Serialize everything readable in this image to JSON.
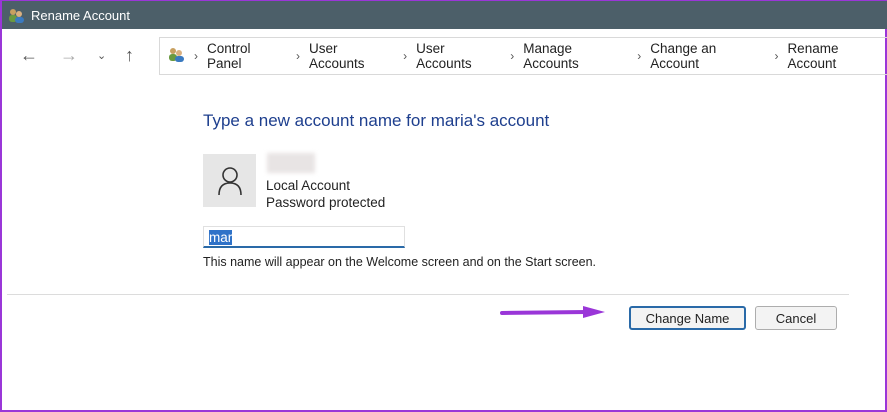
{
  "window": {
    "title": "Rename Account"
  },
  "breadcrumb": [
    "Control Panel",
    "User Accounts",
    "User Accounts",
    "Manage Accounts",
    "Change an Account",
    "Rename Account"
  ],
  "heading": "Type a new account name for maria's account",
  "account": {
    "type": "Local Account",
    "status": "Password protected"
  },
  "name_input": {
    "value": "mar"
  },
  "hint": "This name will appear on the Welcome screen and on the Start screen.",
  "buttons": {
    "change": "Change Name",
    "cancel": "Cancel"
  },
  "colors": {
    "accent": "#1e3f8e",
    "arrow": "#9a36d8"
  }
}
